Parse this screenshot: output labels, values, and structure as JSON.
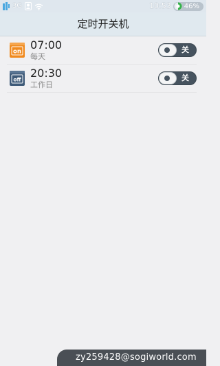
{
  "status_bar": {
    "network": "3G",
    "time": "10:53",
    "battery": "46%",
    "icons": [
      "signal-icon",
      "network-3g-icon",
      "contacts-icon",
      "wifi-icon",
      "battery-icon"
    ]
  },
  "header": {
    "title": "定时开关机"
  },
  "schedules": [
    {
      "icon": "power-on-icon",
      "icon_text": "on",
      "icon_color": "#f08a1e",
      "time": "07:00",
      "repeat": "每天",
      "toggle": "关"
    },
    {
      "icon": "power-off-icon",
      "icon_text": "off",
      "icon_color": "#3e5a78",
      "time": "20:30",
      "repeat": "工作日",
      "toggle": "关"
    }
  ],
  "watermark": {
    "text": "zy259428@sogiworld.com"
  }
}
